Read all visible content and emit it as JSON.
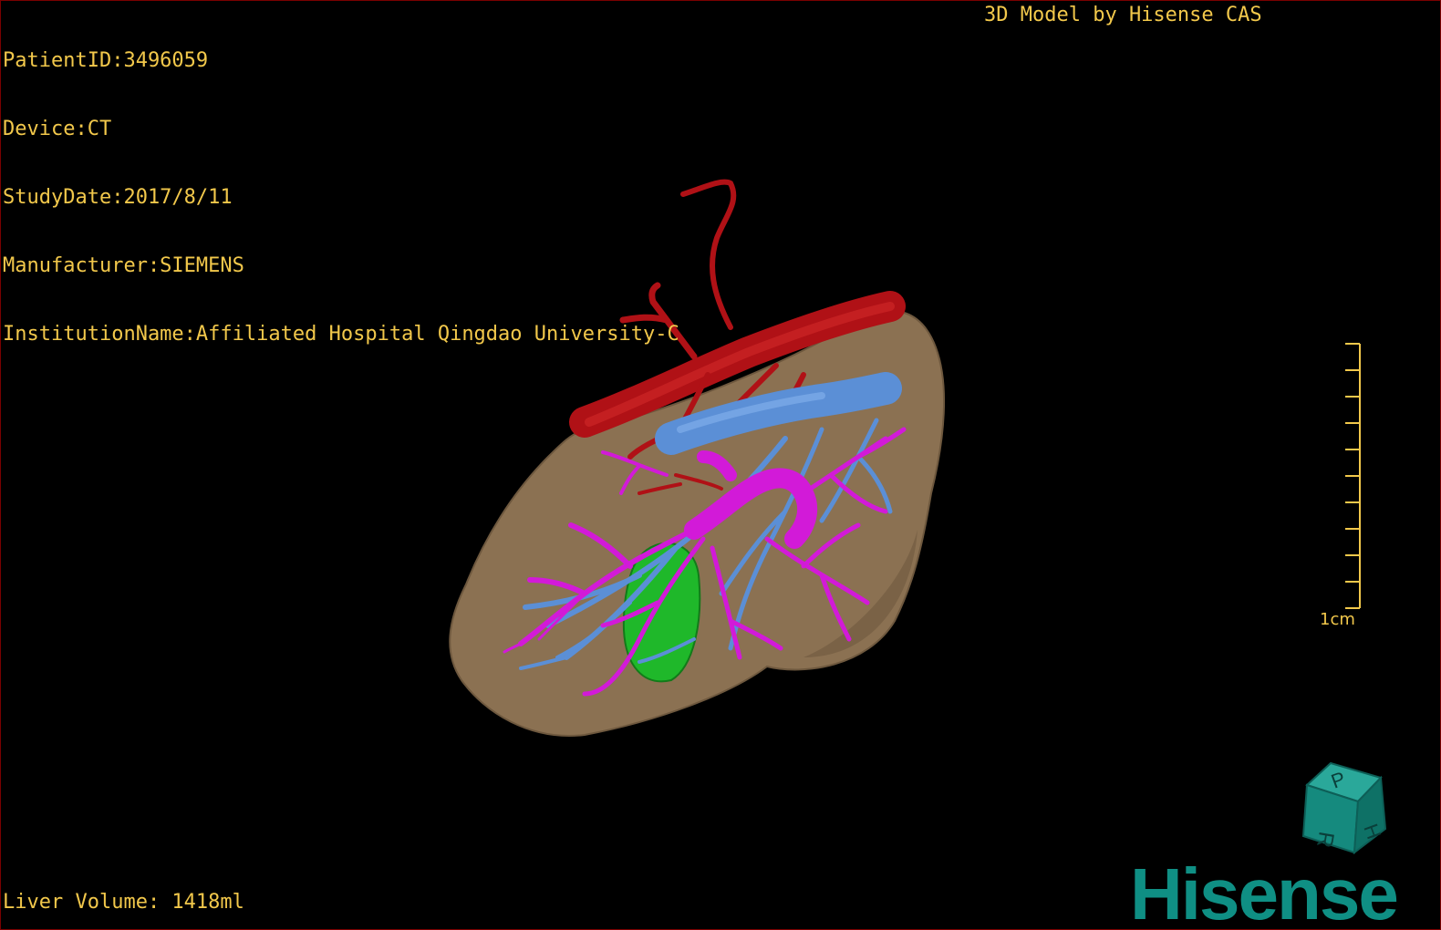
{
  "overlay": {
    "patient_id": "PatientID:3496059",
    "device": "Device:CT",
    "study_date": "StudyDate:2017/8/11",
    "manufacturer": "Manufacturer:SIEMENS",
    "institution": "InstitutionName:Affiliated Hospital Qingdao University-C",
    "model_credit": "3D Model by Hisense CAS",
    "liver_volume": "Liver Volume: 1418ml"
  },
  "scale_bar": {
    "label": "1cm",
    "ticks": 10
  },
  "orientation_cube": {
    "faces": [
      "P",
      "H",
      "R"
    ]
  },
  "brand": {
    "logo_text": "Hisense"
  },
  "colors": {
    "overlay_text": "#f2c84b",
    "liver": "#8b7152",
    "artery": "#b01116",
    "portal_vein": "#5b8fd6",
    "hepatic_vein": "#d21ad8",
    "gallbladder": "#1fb82a",
    "brand": "#0f8f84",
    "viewport_border": "#7a0000"
  }
}
